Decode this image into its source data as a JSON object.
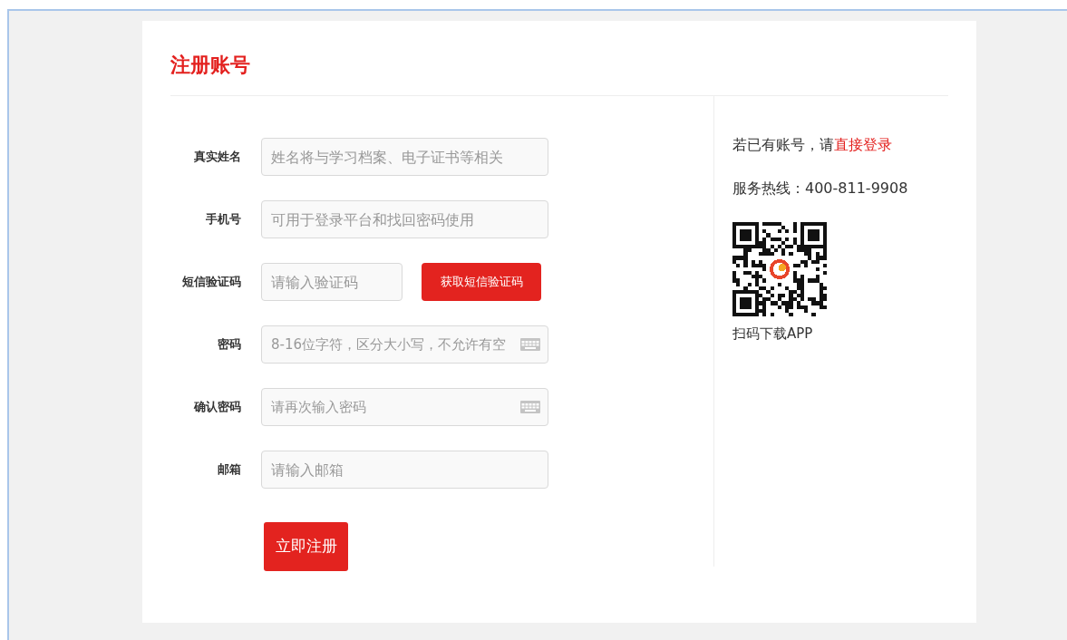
{
  "title": "注册账号",
  "fields": [
    {
      "kind": "text",
      "label": "真实姓名",
      "placeholder": "姓名将与学习档案、电子证书等相关"
    },
    {
      "kind": "text",
      "label": "手机号",
      "placeholder": "可用于登录平台和找回密码使用"
    },
    {
      "kind": "code",
      "label": "短信验证码",
      "placeholder": "请输入验证码",
      "button": "获取短信验证码"
    },
    {
      "kind": "password",
      "label": "密码",
      "placeholder": "8-16位字符，区分大小写，不允许有空"
    },
    {
      "kind": "password",
      "label": "确认密码",
      "placeholder": "请再次输入密码"
    },
    {
      "kind": "text",
      "label": "邮箱",
      "placeholder": "请输入邮箱"
    }
  ],
  "submit": "立即注册",
  "sidebar": {
    "login_prompt": "若已有账号，请",
    "login_link": "直接登录",
    "hotline": "服务热线：400-811-9908",
    "qr_caption": "扫码下载APP"
  }
}
